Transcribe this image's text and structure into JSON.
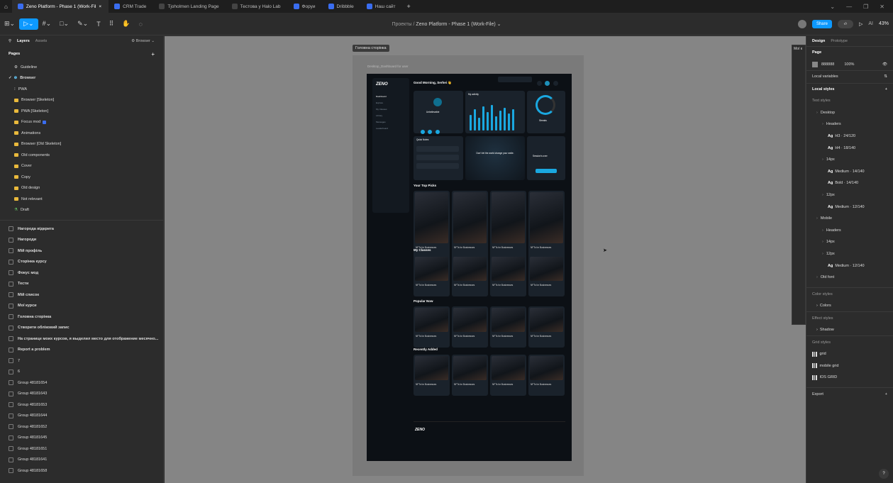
{
  "browser": {
    "tabs": [
      {
        "label": "Zeno Platform - Phase 1 (Work-Fil",
        "active": true
      },
      {
        "label": "CRM Trade",
        "active": false
      },
      {
        "label": "Tjoholmen Landing Page",
        "active": false
      },
      {
        "label": "Тестова у Halo Lab",
        "active": false
      },
      {
        "label": "Форуи",
        "active": false
      },
      {
        "label": "Dribbble",
        "active": false
      },
      {
        "label": "Наш сайт",
        "active": false
      }
    ],
    "close_glyph": "×",
    "new_tab_glyph": "+"
  },
  "toolbar": {
    "breadcrumb_project": "Проекты",
    "breadcrumb_sep": "/",
    "file_title": "Zeno Platform - Phase 1 (Work-File)",
    "share_label": "Share",
    "zoom": "43%",
    "play_glyph": "▷",
    "ai_label": "AI"
  },
  "left_panel": {
    "tabs": [
      "Layers",
      "Assets"
    ],
    "page_selector": "Browser",
    "pages_heading": "Pages",
    "pages": [
      {
        "label": "Guideline",
        "kind": "icon"
      },
      {
        "label": "Browser",
        "kind": "current"
      },
      {
        "label": "PWA",
        "kind": "plain"
      },
      {
        "label": "Browser [Skeleton]",
        "kind": "folder"
      },
      {
        "label": "PWA [Skeleton]",
        "kind": "folder"
      },
      {
        "label": "Focus mod",
        "kind": "folder"
      },
      {
        "label": "Animations",
        "kind": "folder"
      },
      {
        "label": "Browser [Old Skeleton]",
        "kind": "folder"
      },
      {
        "label": "Old components",
        "kind": "folder"
      },
      {
        "label": "Cover",
        "kind": "folder"
      },
      {
        "label": "Copy",
        "kind": "folder"
      },
      {
        "label": "Old design",
        "kind": "folder"
      },
      {
        "label": "Not relevant",
        "kind": "folder"
      },
      {
        "label": "Draft",
        "kind": "draft"
      }
    ],
    "layers": [
      "Нагорода відкрита",
      "Нагороди",
      "Мій профіль",
      "Сторінка курсу",
      "Фокус мод",
      "Тести",
      "Мій список",
      "Мої курси",
      "Головна сторінка",
      "Створити обліковий запис",
      "На странице моих курсов, я выделил место для отображение месячно...",
      "Report a problem",
      "7",
      "6",
      "Group 48181654",
      "Group 48181643",
      "Group 48181653",
      "Group 48181644",
      "Group 48181652",
      "Group 48181645",
      "Group 48181651",
      "Group 48181641",
      "Group 48181658"
    ]
  },
  "canvas": {
    "frame_label": "Головна сторінка",
    "inner_label": "Desktop_Dashboard for user",
    "side_popup_label": "Мої к",
    "mockup": {
      "logo": "ZENO",
      "greeting": "Good Morning, Serhei 👋",
      "sections": [
        "Your Top Picks",
        "My Classes",
        "Popular Now",
        "Recently Added"
      ],
      "card_title": "NFTs for Businesses",
      "footer_logo": "ZENO",
      "nav": [
        "Dashboard",
        "Explore",
        "My Classes",
        "Library",
        "Messages",
        "Leaderboard"
      ],
      "widgets": [
        "Unbelievable",
        "My activity",
        "Streaks",
        "Quick Notes",
        "Don't let the world change your smile.",
        "Session's over"
      ]
    }
  },
  "right_panel": {
    "tabs": [
      "Design",
      "Prototype"
    ],
    "page_heading": "Page",
    "page_color": "888888",
    "page_opacity": "100%",
    "local_variables": "Local variables",
    "local_styles": "Local styles",
    "text_styles": "Text styles",
    "tree": [
      {
        "label": "Desktop",
        "indent": 1,
        "ag": false
      },
      {
        "label": "Headers",
        "indent": 2,
        "ag": false
      },
      {
        "label": "H3 · 24/120",
        "indent": 3,
        "ag": true
      },
      {
        "label": "H4 · 18/140",
        "indent": 3,
        "ag": true
      },
      {
        "label": "14px",
        "indent": 2,
        "ag": false
      },
      {
        "label": "Medium · 14/140",
        "indent": 3,
        "ag": true
      },
      {
        "label": "Bold · 14/140",
        "indent": 3,
        "ag": true
      },
      {
        "label": "12px",
        "indent": 2,
        "ag": false
      },
      {
        "label": "Medium · 12/140",
        "indent": 3,
        "ag": true
      },
      {
        "label": "Mobile",
        "indent": 1,
        "ag": false
      },
      {
        "label": "Headers",
        "indent": 2,
        "ag": false
      },
      {
        "label": "14px",
        "indent": 2,
        "ag": false
      },
      {
        "label": "12px",
        "indent": 2,
        "ag": false
      },
      {
        "label": "Medium · 12/140",
        "indent": 3,
        "ag": true
      },
      {
        "label": "Old font",
        "indent": 1,
        "ag": false
      }
    ],
    "color_styles": "Color styles",
    "colors": "Colors",
    "effect_styles": "Effect styles",
    "shadow": "Shadow",
    "grid_styles": "Grid styles",
    "grids": [
      "grid",
      "mobile grid",
      "IOS GRID"
    ],
    "export": "Export",
    "ag_label": "Ag",
    "help": "?"
  },
  "colors": {
    "accent": "#0d99ff",
    "panel": "#2c2c2c",
    "canvas": "#858585"
  }
}
